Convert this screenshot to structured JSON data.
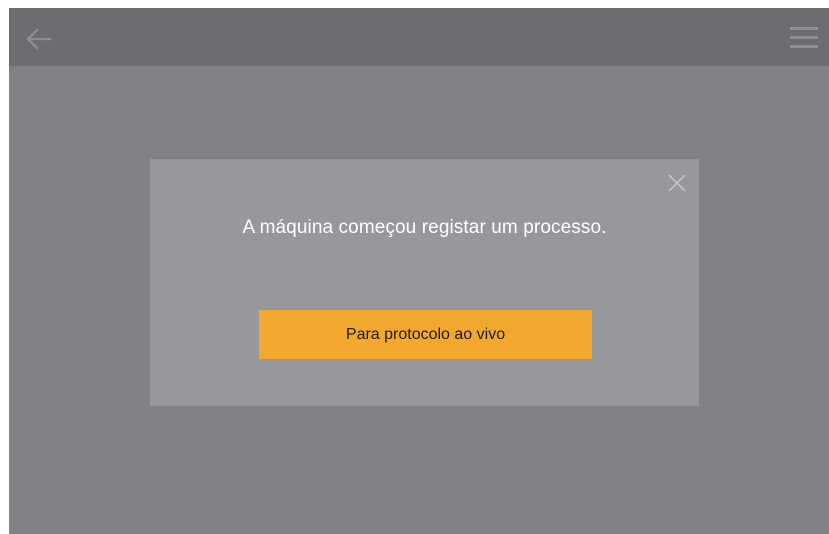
{
  "header": {
    "back_icon": "arrow-left-icon",
    "menu_icon": "hamburger-menu-icon"
  },
  "dialog": {
    "close_icon": "close-icon",
    "message": "A máquina começou registar um processo.",
    "button_label": "Para protocolo ao vivo"
  },
  "colors": {
    "background": "#818285",
    "topbar": "#6c6d71",
    "dialog": "#97989b",
    "accent": "#f2a82e"
  }
}
